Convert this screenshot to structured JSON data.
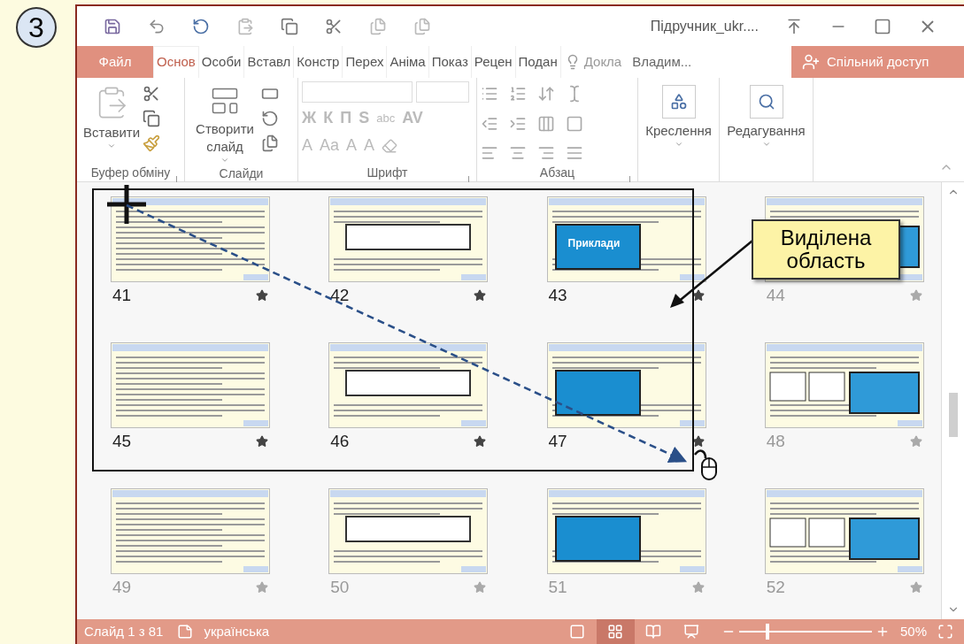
{
  "figure_number": "3",
  "title_bar": {
    "document_title": "Підручник_ukr...."
  },
  "tabs": [
    {
      "label": "Файл",
      "kind": "file",
      "selected": false
    },
    {
      "label": "Основ",
      "kind": "tab",
      "selected": true
    },
    {
      "label": "Особи",
      "kind": "tab",
      "selected": false
    },
    {
      "label": "Вставл",
      "kind": "tab",
      "selected": false
    },
    {
      "label": "Констр",
      "kind": "tab",
      "selected": false
    },
    {
      "label": "Перех",
      "kind": "tab",
      "selected": false
    },
    {
      "label": "Аніма",
      "kind": "tab",
      "selected": false
    },
    {
      "label": "Показ",
      "kind": "tab",
      "selected": false
    },
    {
      "label": "Рецен",
      "kind": "tab",
      "selected": false
    },
    {
      "label": "Подан",
      "kind": "tab",
      "selected": false
    },
    {
      "label": "Докла",
      "kind": "tell",
      "selected": false
    },
    {
      "label": "Владим...",
      "kind": "user",
      "selected": false
    },
    {
      "label": "Спільний доступ",
      "kind": "share",
      "selected": false
    }
  ],
  "ribbon": {
    "groups": [
      {
        "label": "Буфер обміну",
        "kind": "clipboard",
        "big_button": "Вставити",
        "launcher": true
      },
      {
        "label": "Слайди",
        "kind": "slides",
        "big_button": "Створити слайд"
      },
      {
        "label": "Шрифт",
        "kind": "font",
        "launcher": true,
        "row_1": [
          "Ж",
          "К",
          "П",
          "S",
          "abc",
          "AV"
        ],
        "row_2": [
          "A",
          "Aa",
          "A",
          "A"
        ]
      },
      {
        "label": "Абзац",
        "kind": "paragraph",
        "launcher": true
      },
      {
        "kind": "drawing",
        "big_button": "Креслення"
      },
      {
        "kind": "editing",
        "big_button": "Редагування"
      }
    ]
  },
  "slides": [
    {
      "number": "41",
      "selected": true
    },
    {
      "number": "42",
      "selected": true
    },
    {
      "number": "43",
      "selected": true,
      "heading": "Приклади"
    },
    {
      "number": "44",
      "selected": false
    },
    {
      "number": "45",
      "selected": true
    },
    {
      "number": "46",
      "selected": true
    },
    {
      "number": "47",
      "selected": true
    },
    {
      "number": "48",
      "selected": false
    },
    {
      "number": "49",
      "selected": false
    },
    {
      "number": "50",
      "selected": false
    },
    {
      "number": "51",
      "selected": false
    },
    {
      "number": "52",
      "selected": false
    }
  ],
  "annotation": {
    "callout": "Виділена область"
  },
  "status_bar": {
    "slide": "Слайд 1 з 81",
    "language": "українська",
    "views": [
      {
        "kind": "normal",
        "selected": false
      },
      {
        "kind": "sorter",
        "selected": true
      },
      {
        "kind": "reading",
        "selected": false
      },
      {
        "kind": "show",
        "selected": false
      }
    ],
    "zoom_slider": {
      "level": 0.2
    },
    "zoom": "50%"
  }
}
